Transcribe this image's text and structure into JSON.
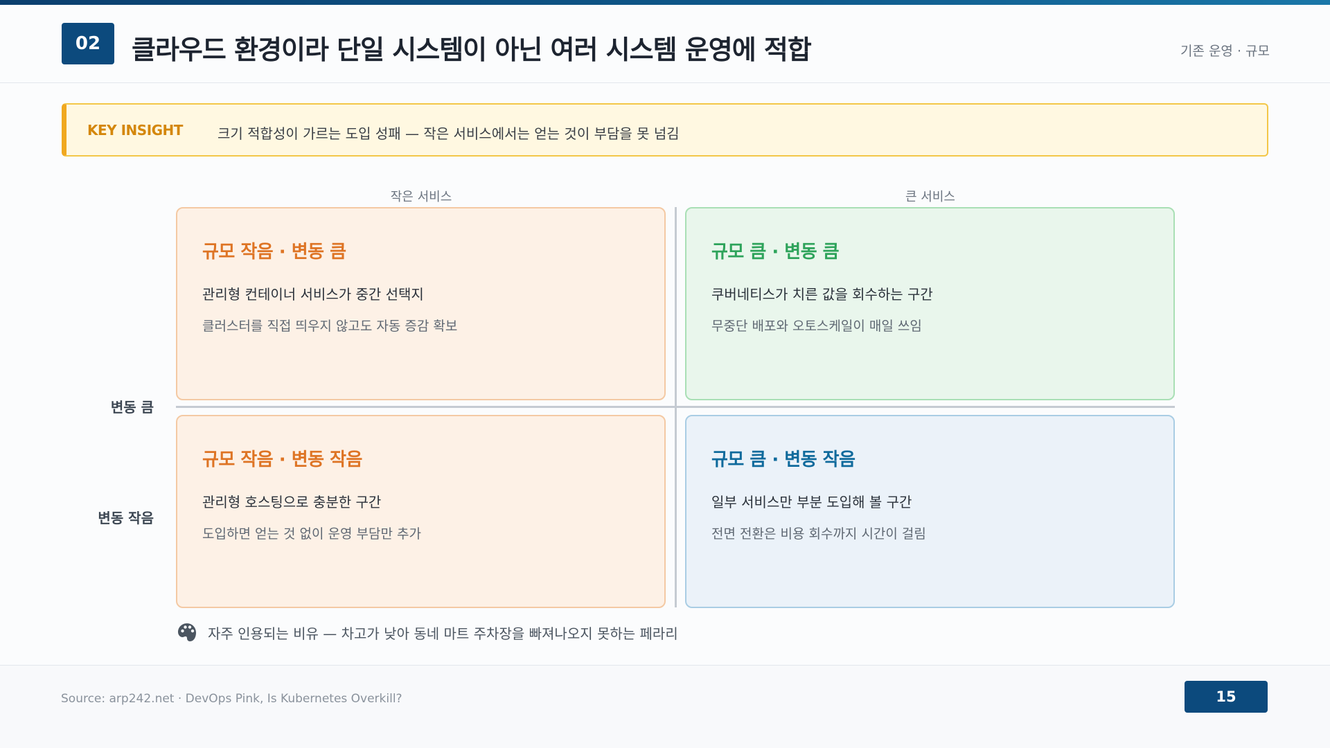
{
  "header": {
    "number": "02",
    "title": "클라우드 환경이라 단일 시스템이 아닌 여러 시스템 운영에 적합",
    "section_tag": "기존 운영 · 규모"
  },
  "insight": {
    "label": "KEY INSIGHT",
    "text": "크기 적합성이 가르는 도입 성패 — 작은 서비스에서는 얻는 것이 부담을 못 넘김"
  },
  "matrix": {
    "col_small": "작은 서비스",
    "col_large": "큰 서비스",
    "row_high": "변동 큼",
    "row_low": "변동 작음",
    "quadrants": {
      "top_left": {
        "title": "규모 작음 · 변동 큼",
        "line1": "관리형 컨테이너 서비스가 중간 선택지",
        "line2": "클러스터를 직접 띄우지 않고도 자동 증감 확보"
      },
      "top_right": {
        "title": "규모 큼 · 변동 큼",
        "line1": "쿠버네티스가 치른 값을 회수하는 구간",
        "line2": "무중단 배포와 오토스케일이 매일 쓰임"
      },
      "bottom_left": {
        "title": "규모 작음 · 변동 작음",
        "line1": "관리형 호스팅으로 충분한 구간",
        "line2": "도입하면 얻는 것 없이 운영 부담만 추가"
      },
      "bottom_right": {
        "title": "규모 큼 · 변동 작음",
        "line1": "일부 서비스만 부분 도입해 볼 구간",
        "line2": "전면 전환은 비용 회수까지 시간이 걸림"
      }
    }
  },
  "note": {
    "icon": "palette-icon",
    "text": "자주 인용되는 비유 — 차고가 낮아 동네 마트 주차장을 빠져나오지 못하는 페라리"
  },
  "footer": {
    "source": "Source: arp242.net · DevOps Pink, Is Kubernetes Overkill?",
    "page": "15"
  },
  "colors": {
    "primary": "#0c4a7d",
    "insight_accent": "#f0a820",
    "orange": "#de7424",
    "green": "#2da35a",
    "blue": "#0f6a9c"
  }
}
